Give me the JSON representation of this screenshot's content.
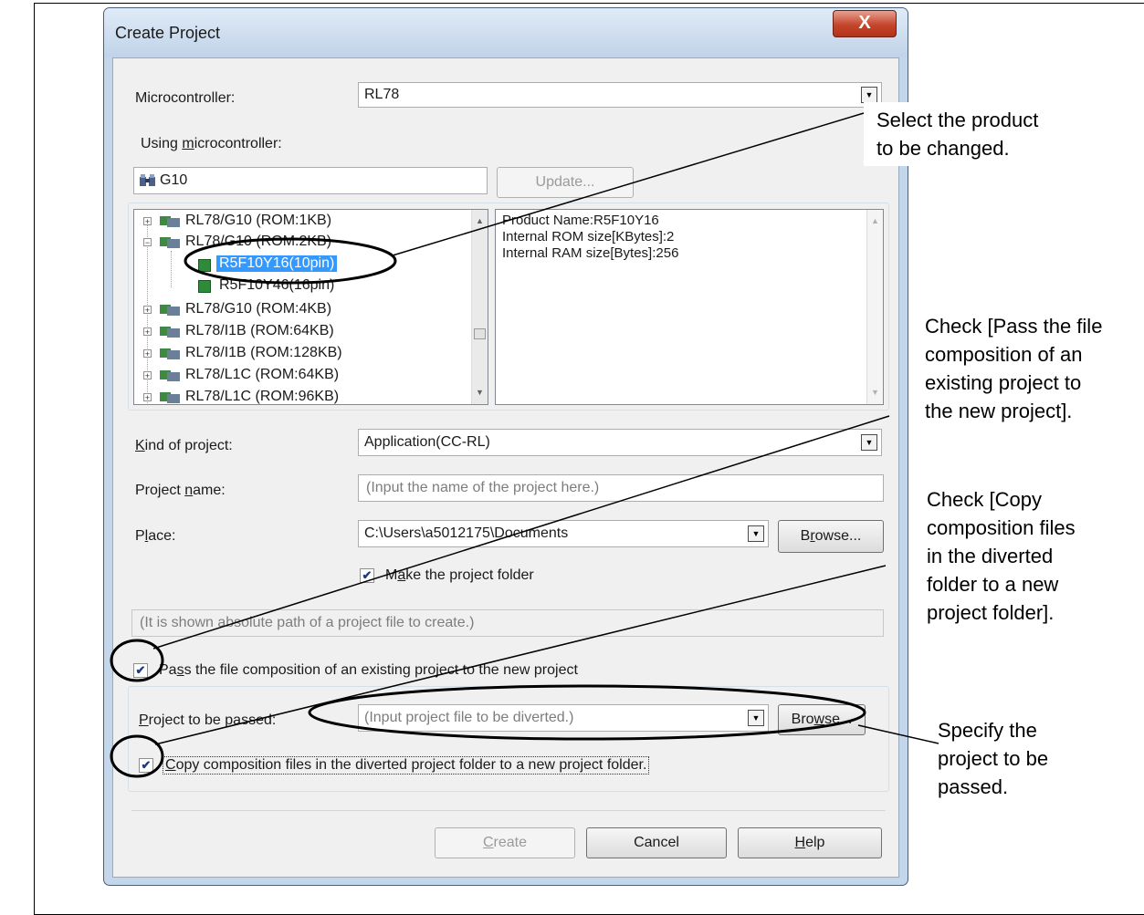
{
  "dialog": {
    "title": "Create Project",
    "close_label": "X",
    "microcontroller": {
      "label": "Microcontroller:",
      "value": "RL78"
    },
    "using_mcu": {
      "label_prefix": "Using ",
      "label_accel": "m",
      "label_rest": "icrocontroller:",
      "search_value": "G10",
      "update_button": "Update...",
      "tree": [
        "RL78/G10 (ROM:1KB)",
        "RL78/G10 (ROM:2KB)",
        "R5F10Y16(10pin)",
        "R5F10Y46(16pin)",
        "RL78/G10 (ROM:4KB)",
        "RL78/I1B (ROM:64KB)",
        "RL78/I1B (ROM:128KB)",
        "RL78/L1C (ROM:64KB)",
        "RL78/L1C (ROM:96KB)"
      ],
      "info_lines": [
        "Product Name:R5F10Y16",
        "Internal ROM size[KBytes]:2",
        "Internal RAM size[Bytes]:256"
      ]
    },
    "kind_of_project": {
      "label_accel": "K",
      "label_rest": "ind of project:",
      "value": "Application(CC-RL)"
    },
    "project_name": {
      "label_prefix": "Project ",
      "label_accel": "n",
      "label_rest": "ame:",
      "placeholder": "(Input the name of the project here.)"
    },
    "place": {
      "label_prefix": "P",
      "label_accel": "l",
      "label_rest": "ace:",
      "value": "C:\\Users\\a5012175\\Documents",
      "browse_prefix": "B",
      "browse_accel": "r",
      "browse_rest": "owse..."
    },
    "make_folder": {
      "checked": true,
      "label_prefix": "M",
      "label_accel": "a",
      "label_rest": "ke the project folder"
    },
    "path_display": "(It is shown absolute path of a project file to create.)",
    "pass_file": {
      "checked": true,
      "label_prefix": "Pa",
      "label_accel": "s",
      "label_rest": "s the file composition of an existing project to the new project"
    },
    "project_to_pass": {
      "label_accel": "P",
      "label_rest": "roject to be passed:",
      "placeholder": "(Input project file to be diverted.)",
      "browse_prefix": "Bro",
      "browse_accel": "w",
      "browse_rest": "se..."
    },
    "copy_files": {
      "checked": true,
      "label_accel": "C",
      "label_rest": "opy composition files in the diverted project folder to a new project folder."
    },
    "buttons": {
      "create_accel": "C",
      "create_rest": "reate",
      "cancel": "Cancel",
      "help_accel": "H",
      "help_rest": "elp"
    }
  },
  "annotations": {
    "select_product": [
      "Select the product",
      "to be changed."
    ],
    "check_pass": [
      "Check [Pass the file",
      "composition of an",
      "existing project to",
      "the new project]."
    ],
    "check_copy": [
      "Check [Copy",
      "composition files",
      "in the diverted",
      "folder to a new",
      "project folder]."
    ],
    "specify_project": [
      "Specify the",
      "project to be",
      "passed."
    ]
  }
}
